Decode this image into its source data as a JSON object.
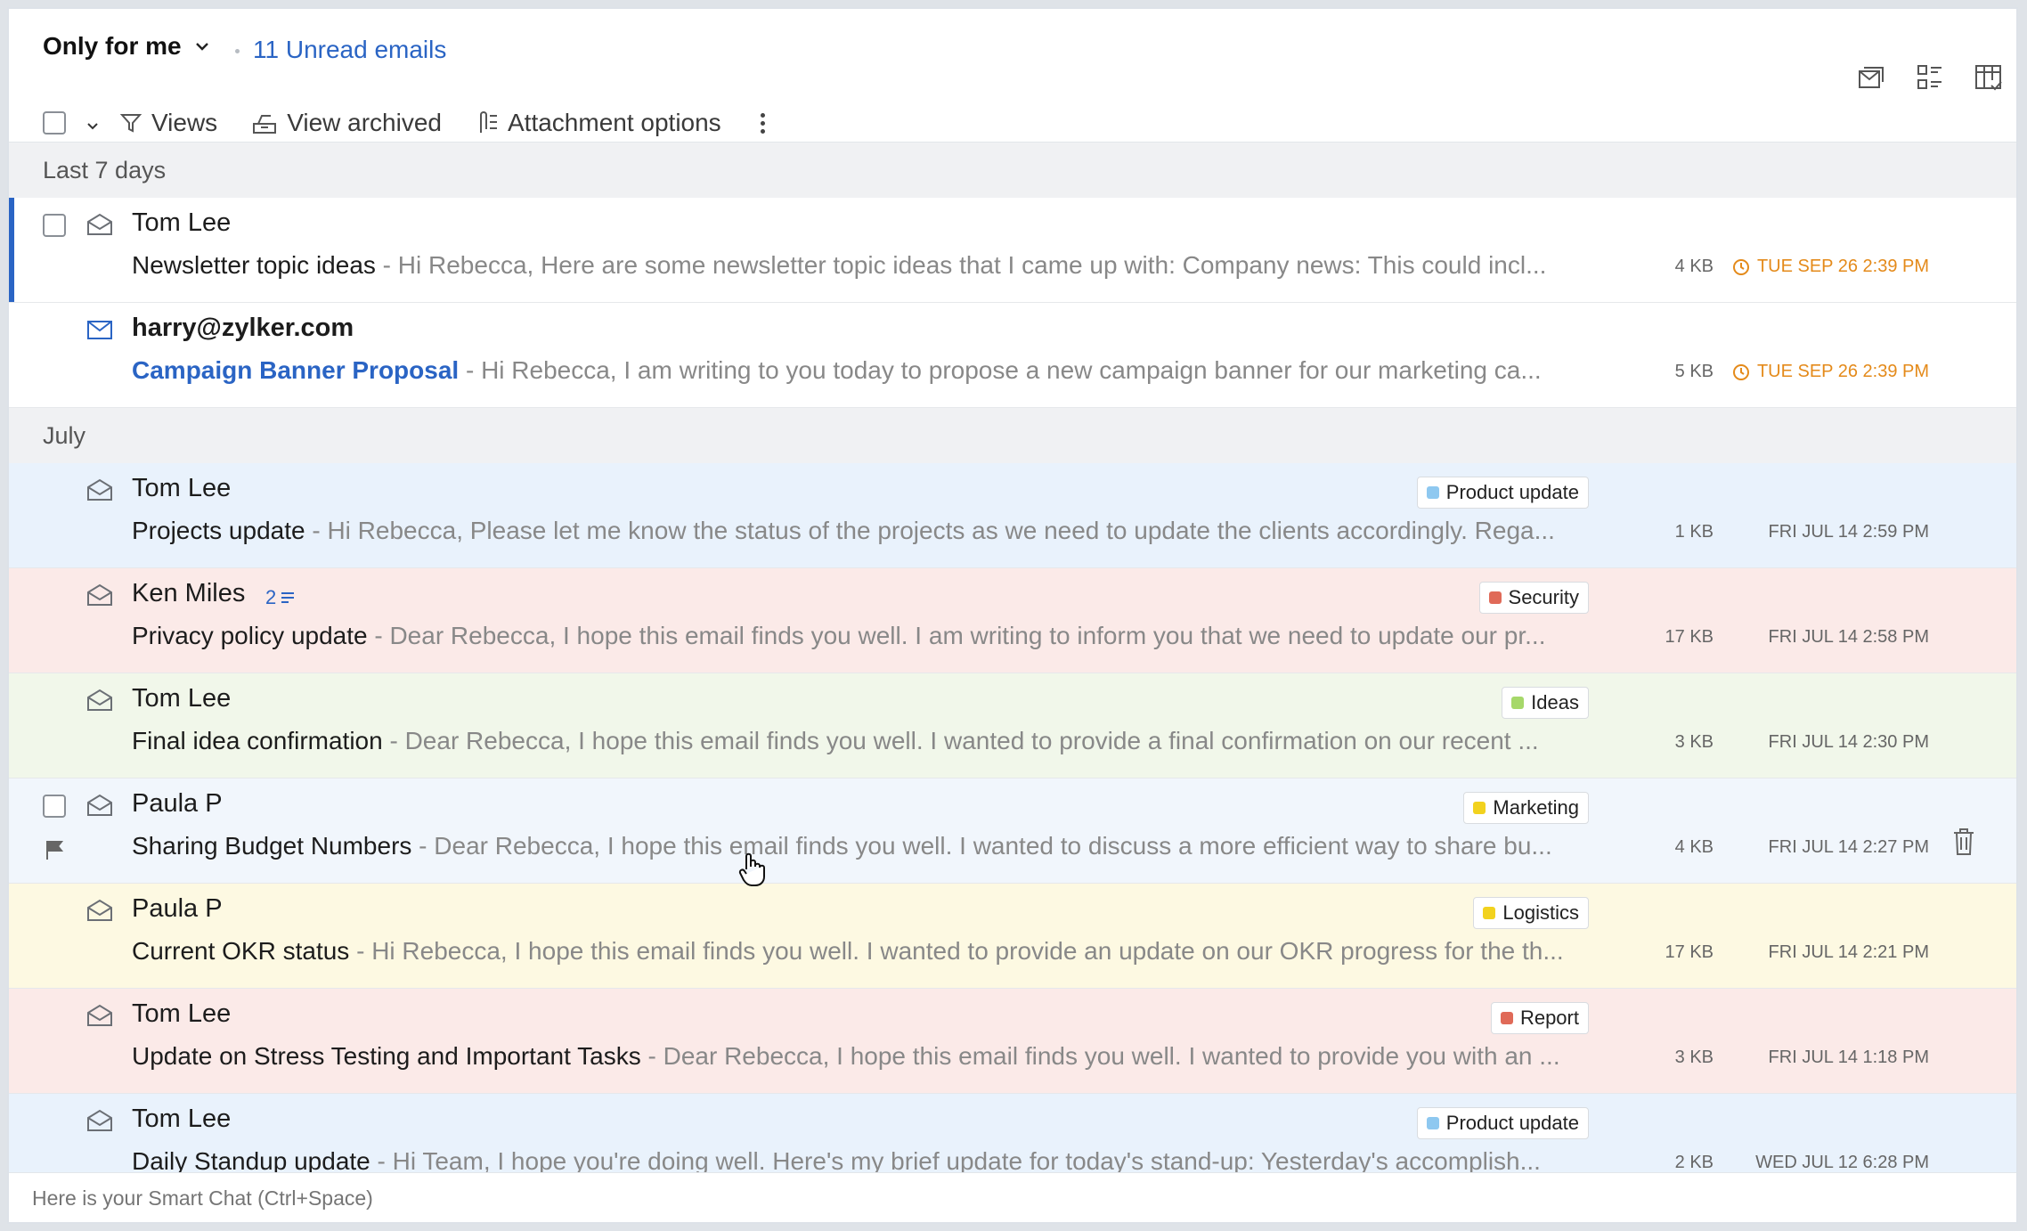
{
  "header": {
    "filter_label": "Only for me",
    "unread_label": "11 Unread emails"
  },
  "toolbar": {
    "views_label": "Views",
    "archived_label": "View archived",
    "attachment_label": "Attachment options"
  },
  "groups": [
    {
      "label": "Last 7 days"
    },
    {
      "label": "July"
    }
  ],
  "emails": [
    {
      "sender": "Tom Lee",
      "subject": "Newsletter topic ideas",
      "preview": " - Hi Rebecca, Here are some newsletter topic ideas that I came up with: Company news: This could incl...",
      "size": "4 KB",
      "date": "TUE SEP 26 2:39 PM",
      "tag": "",
      "tag_color": "",
      "row_bg": "#ffffff",
      "unread": false,
      "selected": true
    },
    {
      "sender": "harry@zylker.com",
      "subject": "Campaign Banner Proposal",
      "preview": " - Hi Rebecca, I am writing to you today to propose a new campaign banner for our marketing ca...",
      "size": "5 KB",
      "date": "TUE SEP 26 2:39 PM",
      "tag": "",
      "tag_color": "",
      "row_bg": "#ffffff",
      "unread": true,
      "selected": false
    },
    {
      "sender": "Tom Lee",
      "subject": "Projects update",
      "preview": " - Hi Rebecca, Please let me know the status of the projects as we need to update the clients accordingly. Rega...",
      "size": "1 KB",
      "date": "FRI JUL 14 2:59 PM",
      "tag": "Product update",
      "tag_color": "#8ec8f0",
      "row_bg": "#e9f2fc",
      "unread": false,
      "selected": false
    },
    {
      "sender": "Ken Miles",
      "thread_count": "2",
      "subject": "Privacy policy update",
      "preview": " - Dear Rebecca, I hope this email finds you well. I am writing to inform you that we need to update our pr...",
      "size": "17 KB",
      "date": "FRI JUL 14 2:58 PM",
      "tag": "Security",
      "tag_color": "#e06a58",
      "row_bg": "#fbeae8",
      "unread": false,
      "selected": false
    },
    {
      "sender": "Tom Lee",
      "subject": "Final idea confirmation",
      "preview": " - Dear Rebecca, I hope this email finds you well. I wanted to provide a final confirmation on our recent ...",
      "size": "3 KB",
      "date": "FRI JUL 14 2:30 PM",
      "tag": "Ideas",
      "tag_color": "#a6d86a",
      "row_bg": "#f1f7ea",
      "unread": false,
      "selected": false
    },
    {
      "sender": "Paula P",
      "subject": "Sharing Budget Numbers",
      "preview": " - Dear Rebecca, I hope this email finds you well. I wanted to discuss a more efficient way to share bu...",
      "size": "4 KB",
      "date": "FRI JUL 14 2:27 PM",
      "tag": "Marketing",
      "tag_color": "#f2d21e",
      "row_bg": "#f1f6fc",
      "unread": false,
      "selected": false,
      "hover": true
    },
    {
      "sender": "Paula P",
      "subject": "Current OKR status",
      "preview": " - Hi Rebecca, I hope this email finds you well. I wanted to provide an update on our OKR progress for the th...",
      "size": "17 KB",
      "date": "FRI JUL 14 2:21 PM",
      "tag": "Logistics",
      "tag_color": "#f2d21e",
      "row_bg": "#fdf9e2",
      "unread": false,
      "selected": false
    },
    {
      "sender": "Tom Lee",
      "subject": "Update on Stress Testing and Important Tasks",
      "preview": " - Dear Rebecca, I hope this email finds you well. I wanted to provide you with an ...",
      "size": "3 KB",
      "date": "FRI JUL 14 1:18 PM",
      "tag": "Report",
      "tag_color": "#e06a58",
      "row_bg": "#fbeae8",
      "unread": false,
      "selected": false
    },
    {
      "sender": "Tom Lee",
      "subject": "Daily Standup update",
      "preview": " - Hi Team, I hope you're doing well. Here's my brief update for today's stand-up: Yesterday's accomplish...",
      "size": "2 KB",
      "date": "WED JUL 12 6:28 PM",
      "tag": "Product update",
      "tag_color": "#8ec8f0",
      "row_bg": "#e9f2fc",
      "unread": false,
      "selected": false
    }
  ],
  "smart_chat": {
    "placeholder": "Here is your Smart Chat (Ctrl+Space)"
  }
}
